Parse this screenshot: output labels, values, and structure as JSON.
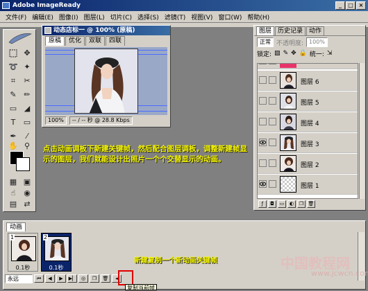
{
  "app": {
    "title": "Adobe ImageReady"
  },
  "window_buttons": [
    "_",
    "□",
    "×"
  ],
  "menu": [
    "文件(F)",
    "编辑(E)",
    "图像(I)",
    "图层(L)",
    "切片(C)",
    "选择(S)",
    "滤镜(T)",
    "视图(V)",
    "窗口(W)",
    "帮助(H)"
  ],
  "document": {
    "title": "动态店标一 @ 100% (原稿)",
    "tabs": [
      "原稿",
      "优化",
      "双联",
      "四联"
    ],
    "zoom": "100%",
    "status": "-- / -- 秒 @ 28.8 Kbps"
  },
  "layers_panel": {
    "tabs": [
      "图层",
      "历史记录",
      "动作"
    ],
    "blend_mode": "正常",
    "opacity_label": "不透明度:",
    "opacity_value": "100%",
    "lock_label": "锁定:",
    "unify_label": "统一:",
    "layers": [
      {
        "name": "",
        "visible": false
      },
      {
        "name": "图层 6",
        "visible": false
      },
      {
        "name": "图层 5",
        "visible": false
      },
      {
        "name": "图层 4",
        "visible": false
      },
      {
        "name": "图层 3",
        "visible": true
      },
      {
        "name": "图层 2",
        "visible": false
      },
      {
        "name": "图层 1",
        "visible": true
      }
    ]
  },
  "annotation": {
    "main": "点击动画调板下新建关键帧，然后配合图层调板，调整新建帧显示的图层，我们就能设计出照片一个个交替显示的动画。",
    "anim": "新建复制一个新动画关键帧"
  },
  "animation_panel": {
    "tab": "动画",
    "frames": [
      {
        "number": "1",
        "delay": "0.1秒"
      },
      {
        "number": "2",
        "delay": "0.1秒"
      }
    ],
    "loop": "永远",
    "tooltip": "复制当前帧"
  },
  "watermark": {
    "main": "中国教程网",
    "url": "www.jcwcn.com"
  },
  "colors": {
    "annotation": "#f5f500",
    "highlight": "#e00000",
    "titlebar": "#0a246a"
  }
}
